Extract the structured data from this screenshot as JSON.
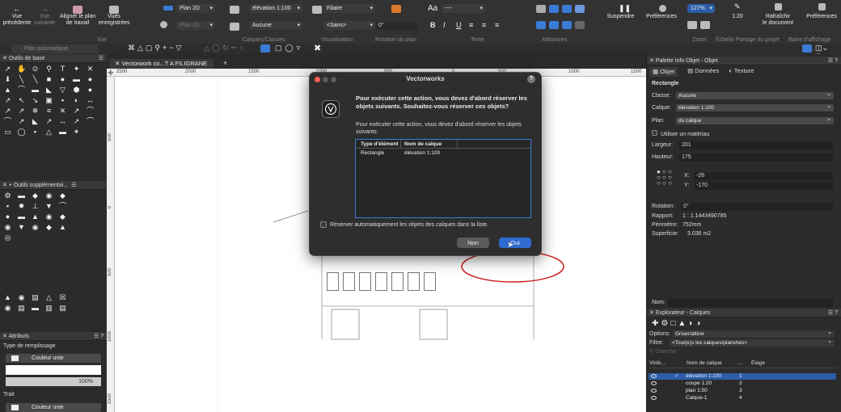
{
  "toolbar": {
    "btn_prev": "Vue\nprécédente",
    "btn_next": "Vue\nsuivante",
    "btn_align": "Aligner le plan\nde travail",
    "btn_saved_views": "Vues\nenregistrées",
    "group_view": "Vue",
    "view_mode": "Plan 2D",
    "view_mode2": "Plan 2D",
    "layer_select": "élévation 1:100",
    "class_select": "Aucune",
    "group_layers_classes": "Calques/Classes",
    "render_mode": "Filaire",
    "render_mode2": "<Sans>",
    "rotation_value": "0°",
    "group_visualisation": "Visualisation",
    "group_rotation": "Rotation du plan",
    "text_size_label": "Aa",
    "text_size_value": "----",
    "text_style": [
      "B",
      "I",
      "U"
    ],
    "group_text": "Texte",
    "group_attraction": "Attirances",
    "btn_suspend": "Suspendre",
    "btn_prefs": "Préférences",
    "zoom_value": "127%",
    "scale_value": "1:20",
    "btn_refresh": "Rafraîchir\nle document",
    "btn_preferences": "Préférences",
    "group_zoom": "Zoom",
    "group_scale": "Échelle",
    "group_share": "Partage du projet",
    "group_display": "Barre d'affichage",
    "plan_auto": "Plan automatique"
  },
  "left_palette": {
    "title": "Outils de base",
    "secondary_title": "Outils supplémentai...",
    "attributes_title": "Attributs",
    "fill_type_label": "Type de remplissage",
    "fill_style": "Couleur unie",
    "opacity": "100%",
    "stroke_label": "Trait",
    "stroke_style": "Couleur unie"
  },
  "document_tab": {
    "title": "Vectorwork co...T A FILIGRANE",
    "add": "+"
  },
  "ruler": {
    "top": [
      "2500",
      "2000",
      "1500",
      "1000",
      "500",
      "0",
      "500",
      "1000",
      "1500"
    ],
    "left": [
      "500",
      "0",
      "500",
      "1000",
      "1500"
    ]
  },
  "dialog": {
    "title": "Vectorworks",
    "help": "?",
    "message": "Pour exécuter cette action, vous devez d'abord réserver les objets suivants. Souhaitez-vous réserver ces objets?",
    "sub_message": "Pour exécuter cette action, vous devez d'abord réserver les objets suivants:",
    "columns": [
      "Type d'élément",
      "Nom de calque"
    ],
    "rows": [
      [
        "Rectangle",
        "élévation 1:100"
      ]
    ],
    "checkbox_label": "Réserver automatiquement les objets des calques dans la liste.",
    "btn_no": "Non",
    "btn_yes": "Oui"
  },
  "info_palette": {
    "title": "Palette Info Objet - Objet",
    "tabs": [
      "Objet",
      "Données",
      "Texture"
    ],
    "object_type": "Rectangle",
    "class_label": "Classe:",
    "class_value": "Aucune",
    "layer_label": "Calque:",
    "layer_value": "élévation 1:100",
    "plane_label": "Plan:",
    "plane_value": "du calque",
    "use_material": "Utiliser un matériau",
    "width_label": "Largeur:",
    "width_value": "201",
    "height_label": "Hauteur:",
    "height_value": "175",
    "x_label": "X:",
    "x_value": "-26",
    "y_label": "Y:",
    "y_value": "-170",
    "rotation_label": "Rotation:",
    "rotation_value": "0°",
    "ratio_label": "Rapport:",
    "ratio_value": "1 : 1.1443490785",
    "perimeter_label": "Périmètre:",
    "perimeter_value": "752mm",
    "area_label": "Superficie:",
    "area_value": "3.036 m2",
    "name_label": "Nom:"
  },
  "layers_palette": {
    "title": "Explorateur - Calques",
    "options_label": "Options:",
    "options_value": "Griser/attirer",
    "filter_label": "Filtre:",
    "filter_value": "<Tout(e)s les calques/planches>",
    "search_placeholder": "Cherche",
    "columns": [
      "Visib...",
      "Nom de calque",
      "...",
      "Étage"
    ],
    "rows": [
      {
        "name": "élévation 1:100",
        "num": "1"
      },
      {
        "name": "coupe 1:20",
        "num": "2"
      },
      {
        "name": "plan 1:50",
        "num": "3"
      },
      {
        "name": "Calque-1",
        "num": "4"
      }
    ]
  },
  "colors": {
    "accent": "#3a7bd5",
    "annotation": "#cc2222",
    "selection": "#2c5da8"
  }
}
